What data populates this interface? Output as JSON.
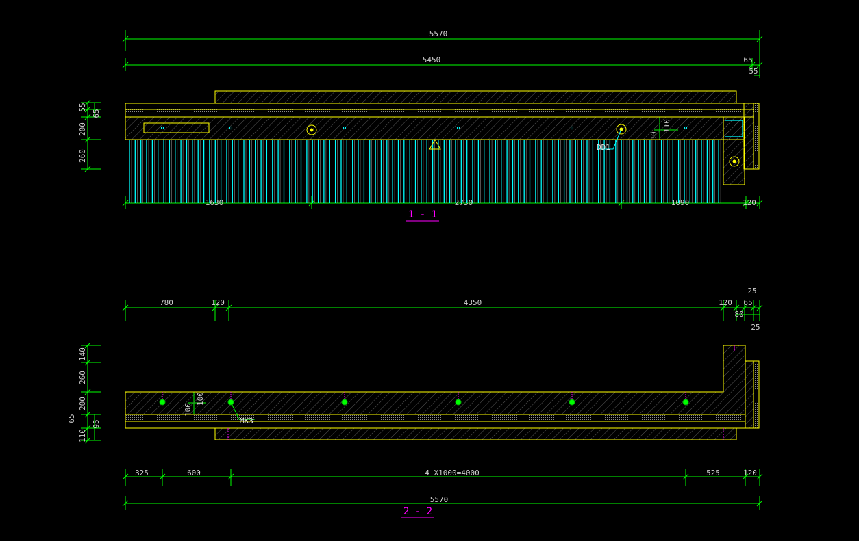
{
  "colors": {
    "background": "#000000",
    "dimension_line": "#00ff00",
    "outline": "#ffff00",
    "rebar": "#00ffff",
    "section_title": "#ff00ff",
    "text": "#cfcfcf"
  },
  "section_1": {
    "title": "1 - 1",
    "dims": {
      "overall": "5570",
      "inner": "5450",
      "right_65": "65",
      "right_55": "55",
      "seg_a": "1630",
      "seg_b": "2730",
      "seg_c": "1090",
      "seg_d": "120"
    },
    "vertical_dims": {
      "v55": "55",
      "v65": "65",
      "v200": "200",
      "v260": "260",
      "v110": "110",
      "v30": "30"
    },
    "callout": "DD1"
  },
  "section_2": {
    "title": "2 - 2",
    "top_dims": {
      "d780": "780",
      "d120a": "120",
      "d4350": "4350",
      "d120b": "120",
      "d65": "65",
      "d25a": "25",
      "d80": "80",
      "d25b": "25"
    },
    "bottom_dims": {
      "d325": "325",
      "d600": "600",
      "d4000": "4 X1000=4000",
      "d525": "525",
      "d120": "120",
      "overall": "5570"
    },
    "vertical_dims": {
      "v140": "140",
      "v260": "260",
      "v200": "200",
      "v95": "95",
      "v110": "110",
      "v65": "65",
      "v100a": "100",
      "v100b": "100"
    },
    "callout": "MK3"
  }
}
